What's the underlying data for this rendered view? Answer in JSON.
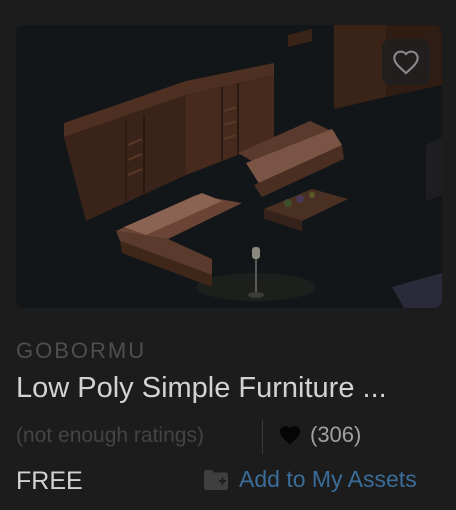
{
  "card": {
    "publisher": "GOBORMU",
    "title": "Low Poly Simple Furniture ...",
    "rating_text": "(not enough ratings)",
    "likes_count": "(306)",
    "price": "FREE",
    "add_to_assets_label": "Add to My Assets"
  },
  "icons": {
    "favorite": "heart-outline-icon",
    "likes": "heart-filled-icon",
    "add": "folder-plus-icon"
  },
  "colors": {
    "link": "#3a6d99",
    "title": "#d2d2d2",
    "muted": "#444444"
  }
}
